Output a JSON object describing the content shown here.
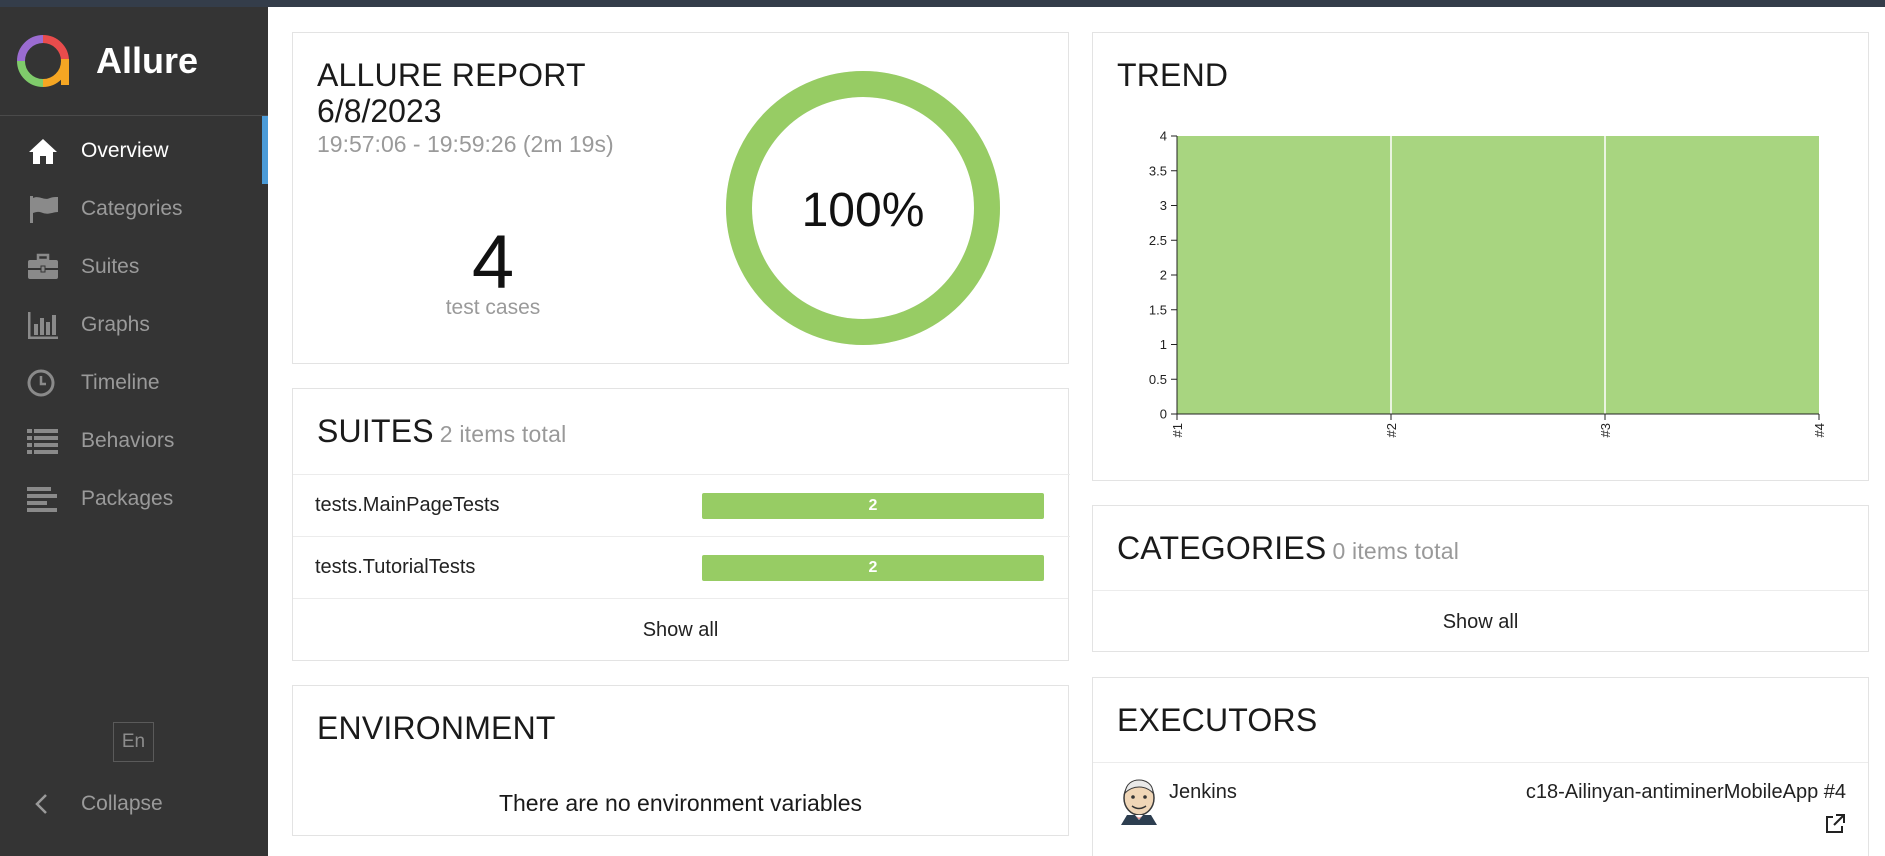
{
  "brand": {
    "name": "Allure"
  },
  "nav": {
    "items": [
      {
        "label": "Overview",
        "icon": "home-icon",
        "active": true
      },
      {
        "label": "Categories",
        "icon": "flag-icon",
        "active": false
      },
      {
        "label": "Suites",
        "icon": "briefcase-icon",
        "active": false
      },
      {
        "label": "Graphs",
        "icon": "bar-chart-icon",
        "active": false
      },
      {
        "label": "Timeline",
        "icon": "clock-icon",
        "active": false
      },
      {
        "label": "Behaviors",
        "icon": "list-icon",
        "active": false
      },
      {
        "label": "Packages",
        "icon": "align-left-icon",
        "active": false
      }
    ],
    "language": "En",
    "collapse_label": "Collapse"
  },
  "summary": {
    "title": "ALLURE REPORT",
    "date": "6/8/2023",
    "time_range": "19:57:06 - 19:59:26 (2m 19s)",
    "count": "4",
    "count_label": "test cases",
    "percent": "100%",
    "passed_fraction": 1.0
  },
  "suites": {
    "title": "SUITES",
    "subtitle": "2 items total",
    "rows": [
      {
        "name": "tests.MainPageTests",
        "count": "2"
      },
      {
        "name": "tests.TutorialTests",
        "count": "2"
      }
    ],
    "show_all": "Show all"
  },
  "environment": {
    "title": "ENVIRONMENT",
    "empty_text": "There are no environment variables"
  },
  "trend": {
    "title": "TREND"
  },
  "chart_data": {
    "type": "area",
    "title": "",
    "xlabel": "",
    "ylabel": "",
    "x": [
      "#1",
      "#2",
      "#3",
      "#4"
    ],
    "series": [
      {
        "values": [
          4,
          4,
          4,
          4
        ]
      }
    ],
    "ylim": [
      0,
      4
    ],
    "yticks": [
      "0",
      "0.5",
      "1",
      "1.5",
      "2",
      "2.5",
      "3",
      "3.5",
      "4"
    ],
    "grid": false
  },
  "categories": {
    "title": "CATEGORIES",
    "subtitle": "0 items total",
    "show_all": "Show all"
  },
  "executors": {
    "title": "EXECUTORS",
    "name": "Jenkins",
    "build": "c18-Ailinyan-antiminerMobileApp #4"
  },
  "colors": {
    "passed": "#97cc64",
    "trend_fill": "#a8d580",
    "sidebar": "#343434",
    "active_marker": "#4b9bd8"
  }
}
